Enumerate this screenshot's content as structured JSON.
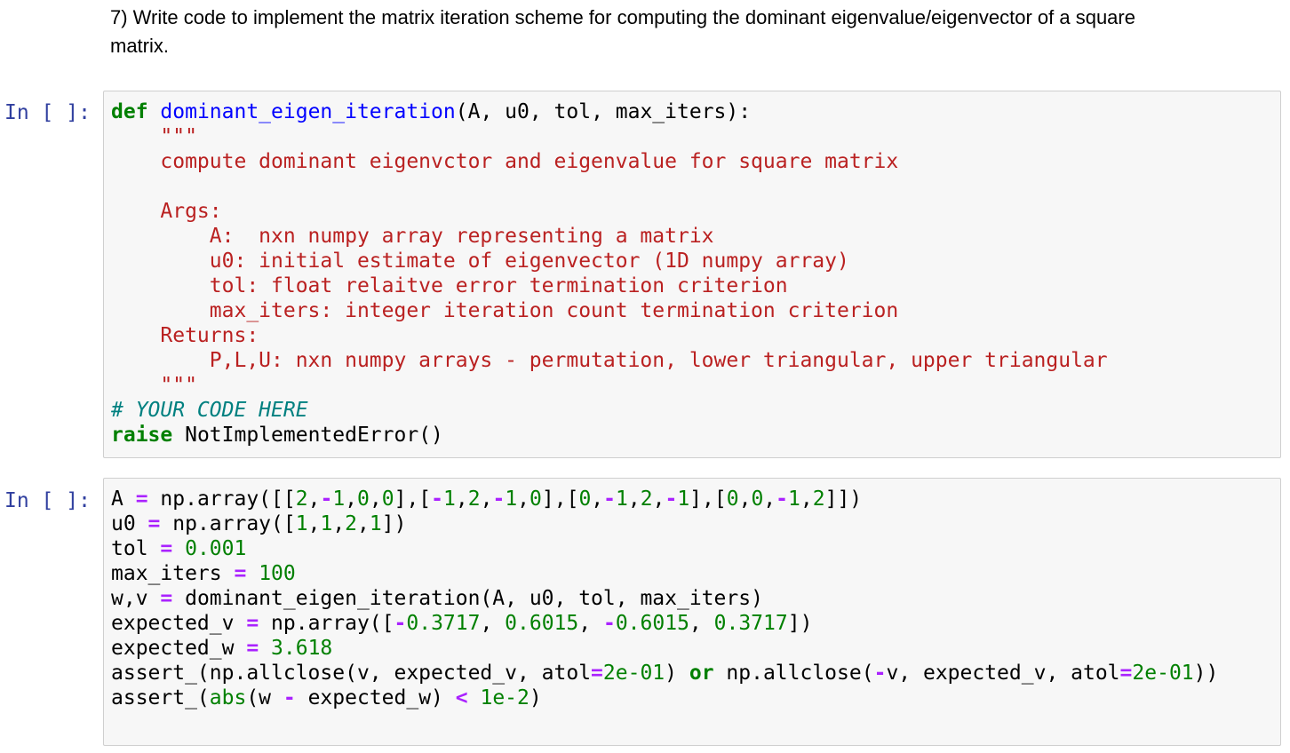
{
  "markdown": {
    "line1": "7) Write code to implement the matrix iteration scheme for computing the dominant eigenvalue/eigenvector of a square",
    "line2": "matrix."
  },
  "cells": [
    {
      "prompt": "In [ ]:",
      "lines": [
        [
          {
            "t": "def",
            "c": "kw"
          },
          {
            "t": " "
          },
          {
            "t": "dominant_eigen_iteration",
            "c": "fn"
          },
          {
            "t": "(A, u0, tol, max_iters):"
          }
        ],
        [
          {
            "t": "    "
          },
          {
            "t": "\"\"\"",
            "c": "str"
          }
        ],
        [
          {
            "t": "    "
          },
          {
            "t": "compute dominant eigenvctor and eigenvalue for square matrix",
            "c": "str"
          }
        ],
        [
          {
            "t": ""
          }
        ],
        [
          {
            "t": "    "
          },
          {
            "t": "Args:",
            "c": "str"
          }
        ],
        [
          {
            "t": "        "
          },
          {
            "t": "A:  nxn numpy array representing a matrix",
            "c": "str"
          }
        ],
        [
          {
            "t": "        "
          },
          {
            "t": "u0: initial estimate of eigenvector (1D numpy array)",
            "c": "str"
          }
        ],
        [
          {
            "t": "        "
          },
          {
            "t": "tol: float relaitve error termination criterion",
            "c": "str"
          }
        ],
        [
          {
            "t": "        "
          },
          {
            "t": "max_iters: integer iteration count termination criterion",
            "c": "str"
          }
        ],
        [
          {
            "t": "    "
          },
          {
            "t": "Returns:",
            "c": "str"
          }
        ],
        [
          {
            "t": "        "
          },
          {
            "t": "P,L,U: nxn numpy arrays - permutation, lower triangular, upper triangular",
            "c": "str"
          }
        ],
        [
          {
            "t": "    "
          },
          {
            "t": "\"\"\"",
            "c": "str"
          }
        ],
        [
          {
            "t": "# YOUR CODE HERE",
            "c": "cmt"
          }
        ],
        [
          {
            "t": "raise",
            "c": "kw"
          },
          {
            "t": " NotImplementedError()"
          }
        ]
      ]
    },
    {
      "prompt": "In [ ]:",
      "lines": [
        [
          {
            "t": "A "
          },
          {
            "t": "=",
            "c": "op"
          },
          {
            "t": " np.array([["
          },
          {
            "t": "2",
            "c": "num"
          },
          {
            "t": ","
          },
          {
            "t": "-",
            "c": "op"
          },
          {
            "t": "1",
            "c": "num"
          },
          {
            "t": ","
          },
          {
            "t": "0",
            "c": "num"
          },
          {
            "t": ","
          },
          {
            "t": "0",
            "c": "num"
          },
          {
            "t": "],["
          },
          {
            "t": "-",
            "c": "op"
          },
          {
            "t": "1",
            "c": "num"
          },
          {
            "t": ","
          },
          {
            "t": "2",
            "c": "num"
          },
          {
            "t": ","
          },
          {
            "t": "-",
            "c": "op"
          },
          {
            "t": "1",
            "c": "num"
          },
          {
            "t": ","
          },
          {
            "t": "0",
            "c": "num"
          },
          {
            "t": "],["
          },
          {
            "t": "0",
            "c": "num"
          },
          {
            "t": ","
          },
          {
            "t": "-",
            "c": "op"
          },
          {
            "t": "1",
            "c": "num"
          },
          {
            "t": ","
          },
          {
            "t": "2",
            "c": "num"
          },
          {
            "t": ","
          },
          {
            "t": "-",
            "c": "op"
          },
          {
            "t": "1",
            "c": "num"
          },
          {
            "t": "],["
          },
          {
            "t": "0",
            "c": "num"
          },
          {
            "t": ","
          },
          {
            "t": "0",
            "c": "num"
          },
          {
            "t": ","
          },
          {
            "t": "-",
            "c": "op"
          },
          {
            "t": "1",
            "c": "num"
          },
          {
            "t": ","
          },
          {
            "t": "2",
            "c": "num"
          },
          {
            "t": "]])"
          }
        ],
        [
          {
            "t": "u0 "
          },
          {
            "t": "=",
            "c": "op"
          },
          {
            "t": " np.array(["
          },
          {
            "t": "1",
            "c": "num"
          },
          {
            "t": ","
          },
          {
            "t": "1",
            "c": "num"
          },
          {
            "t": ","
          },
          {
            "t": "2",
            "c": "num"
          },
          {
            "t": ","
          },
          {
            "t": "1",
            "c": "num"
          },
          {
            "t": "])"
          }
        ],
        [
          {
            "t": "tol "
          },
          {
            "t": "=",
            "c": "op"
          },
          {
            "t": " "
          },
          {
            "t": "0.001",
            "c": "num"
          }
        ],
        [
          {
            "t": "max_iters "
          },
          {
            "t": "=",
            "c": "op"
          },
          {
            "t": " "
          },
          {
            "t": "100",
            "c": "num"
          }
        ],
        [
          {
            "t": "w,v "
          },
          {
            "t": "=",
            "c": "op"
          },
          {
            "t": " dominant_eigen_iteration(A, u0, tol, max_iters)"
          }
        ],
        [
          {
            "t": "expected_v "
          },
          {
            "t": "=",
            "c": "op"
          },
          {
            "t": " np.array(["
          },
          {
            "t": "-",
            "c": "op"
          },
          {
            "t": "0.3717",
            "c": "num"
          },
          {
            "t": ", "
          },
          {
            "t": "0.6015",
            "c": "num"
          },
          {
            "t": ", "
          },
          {
            "t": "-",
            "c": "op"
          },
          {
            "t": "0.6015",
            "c": "num"
          },
          {
            "t": ", "
          },
          {
            "t": "0.3717",
            "c": "num"
          },
          {
            "t": "])"
          }
        ],
        [
          {
            "t": "expected_w "
          },
          {
            "t": "=",
            "c": "op"
          },
          {
            "t": " "
          },
          {
            "t": "3.618",
            "c": "num"
          }
        ],
        [
          {
            "t": "assert_(np.allclose(v, expected_v, atol"
          },
          {
            "t": "=",
            "c": "op"
          },
          {
            "t": "2e-01",
            "c": "num"
          },
          {
            "t": ") "
          },
          {
            "t": "or",
            "c": "kw"
          },
          {
            "t": " np.allclose("
          },
          {
            "t": "-",
            "c": "op"
          },
          {
            "t": "v, expected_v, atol"
          },
          {
            "t": "=",
            "c": "op"
          },
          {
            "t": "2e-01",
            "c": "num"
          },
          {
            "t": "))"
          }
        ],
        [
          {
            "t": "assert_("
          },
          {
            "t": "abs",
            "c": "bi"
          },
          {
            "t": "(w "
          },
          {
            "t": "-",
            "c": "op"
          },
          {
            "t": " expected_w) "
          },
          {
            "t": "<",
            "c": "op"
          },
          {
            "t": " "
          },
          {
            "t": "1e-2",
            "c": "num"
          },
          {
            "t": ")"
          }
        ]
      ]
    }
  ]
}
